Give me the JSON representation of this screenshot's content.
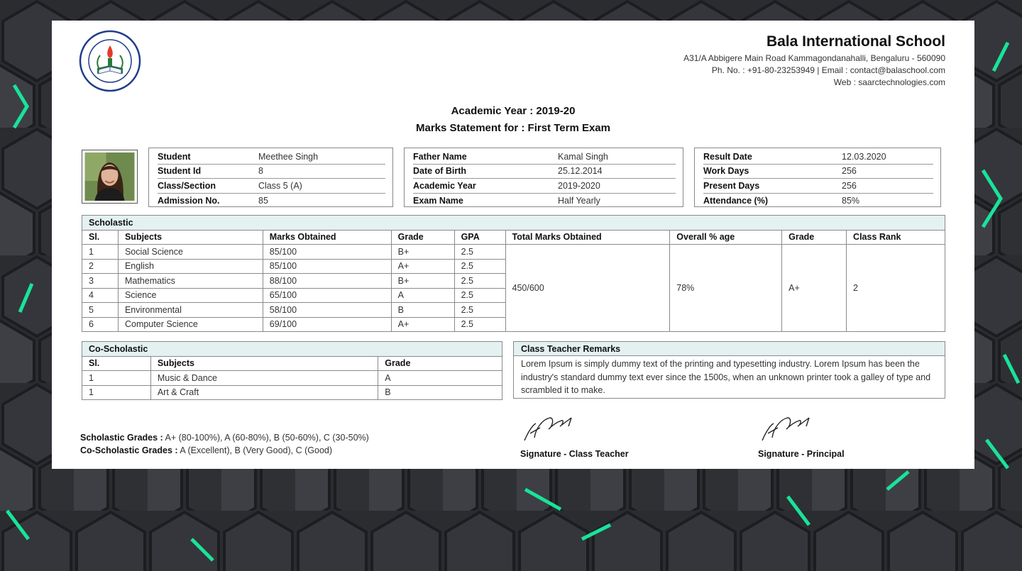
{
  "school": {
    "name": "Bala International School",
    "address": "A31/A Abbigere Main Road Kammagondanahalli, Bengaluru - 560090",
    "contact": "Ph. No. : +91-80-23253949 | Email : contact@balaschool.com",
    "web": "Web : saarctechnologies.com",
    "logo_text_top": "TIKAY ELEMENTARY SCHOOL",
    "logo_text_bottom": "CITY OF MALOLOS, BULACAN",
    "logo_year": "1947"
  },
  "heading": {
    "academic_year": "Academic Year : 2019-20",
    "statement": "Marks Statement for : First Term Exam"
  },
  "student_info": [
    {
      "label": "Student",
      "value": "Meethee Singh"
    },
    {
      "label": "Student Id",
      "value": "8"
    },
    {
      "label": "Class/Section",
      "value": "Class 5 (A)"
    },
    {
      "label": "Admission No.",
      "value": "85"
    }
  ],
  "family_info": [
    {
      "label": "Father Name",
      "value": "Kamal Singh"
    },
    {
      "label": "Date of Birth",
      "value": "25.12.2014"
    },
    {
      "label": "Academic Year",
      "value": "2019-2020"
    },
    {
      "label": "Exam Name",
      "value": "Half Yearly"
    }
  ],
  "result_info": [
    {
      "label": "Result Date",
      "value": "12.03.2020"
    },
    {
      "label": "Work Days",
      "value": "256"
    },
    {
      "label": "Present Days",
      "value": "256"
    },
    {
      "label": "Attendance (%)",
      "value": "85%"
    }
  ],
  "scholastic": {
    "title": "Scholastic",
    "headers": [
      "Sl.",
      "Subjects",
      "Marks Obtained",
      "Grade",
      "GPA",
      "Total Marks Obtained",
      "Overall % age",
      "Grade",
      "Class Rank"
    ],
    "rows": [
      [
        "1",
        "Social Science",
        "85/100",
        "B+",
        "2.5"
      ],
      [
        "2",
        "English",
        "85/100",
        "A+",
        "2.5"
      ],
      [
        "3",
        "Mathematics",
        "88/100",
        "B+",
        "2.5"
      ],
      [
        "4",
        "Science",
        "65/100",
        "A",
        "2.5"
      ],
      [
        "5",
        "Environmental",
        "58/100",
        "B",
        "2.5"
      ],
      [
        "6",
        "Computer Science",
        "69/100",
        "A+",
        "2.5"
      ]
    ],
    "total_marks": "450/600",
    "overall_percent": "78%",
    "overall_grade": "A+",
    "class_rank": "2"
  },
  "co_scholastic": {
    "title": "Co-Scholastic",
    "headers": [
      "Sl.",
      "Subjects",
      "Grade"
    ],
    "rows": [
      [
        "1",
        "Music & Dance",
        "A"
      ],
      [
        "1",
        "Art & Craft",
        "B"
      ]
    ]
  },
  "remarks": {
    "title": "Class Teacher Remarks",
    "text": "Lorem Ipsum is simply dummy text of the printing and typesetting industry. Lorem Ipsum has been the industry's standard dummy text ever since the 1500s, when an unknown printer took a galley of type and scrambled it to make."
  },
  "grades_legend": {
    "scholastic_label": "Scholastic Grades :",
    "scholastic_value": "A+ (80-100%), A (60-80%), B (50-60%), C (30-50%)",
    "co_label": "Co-Scholastic Grades :",
    "co_value": "A (Excellent), B (Very Good), C (Good)"
  },
  "signatures": {
    "teacher": "Signature - Class Teacher",
    "principal": "Signature - Principal"
  },
  "colors": {
    "section_bg": "#e4f1f1",
    "accent_green": "#19e39a",
    "background": "#2a2c30"
  }
}
